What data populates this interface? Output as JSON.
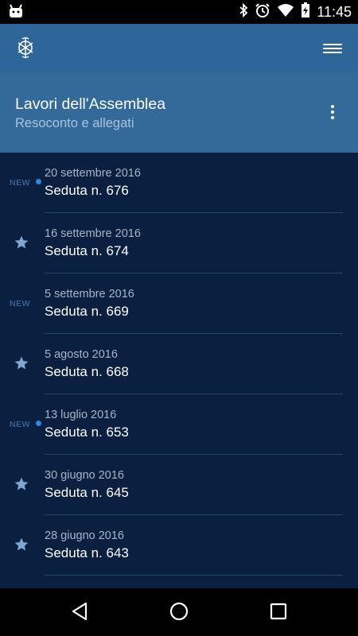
{
  "status_bar": {
    "time": "11:45",
    "icons": [
      "android-icon",
      "bluetooth-icon",
      "alarm-icon",
      "wifi-icon",
      "battery-charging-icon"
    ]
  },
  "app_bar": {
    "logo_icon": "assembly-logo-icon",
    "menu_icon": "hamburger-menu-icon"
  },
  "header": {
    "title": "Lavori dell'Assemblea",
    "subtitle": "Resoconto e allegati",
    "overflow_icon": "more-vert-icon"
  },
  "sessions": [
    {
      "date": "20 settembre 2016",
      "name": "Seduta n. 676",
      "marker": "new",
      "new_label": "NEW"
    },
    {
      "date": "16 settembre 2016",
      "name": "Seduta n. 674",
      "marker": "star"
    },
    {
      "date": "5 settembre 2016",
      "name": "Seduta n. 669",
      "marker": "new-label",
      "new_label": "NEW"
    },
    {
      "date": "5 agosto 2016",
      "name": "Seduta n. 668",
      "marker": "star"
    },
    {
      "date": "13 luglio 2016",
      "name": "Seduta n. 653",
      "marker": "new",
      "new_label": "NEW"
    },
    {
      "date": "30 giugno 2016",
      "name": "Seduta n. 645",
      "marker": "star"
    },
    {
      "date": "28 giugno 2016",
      "name": "Seduta n. 643",
      "marker": "star"
    }
  ],
  "colors": {
    "app_bar": "#2f6699",
    "header": "#336a9a",
    "background": "#0b2040",
    "new_dot": "#2e86e6",
    "star": "#7ea6d1"
  },
  "nav_bar": {
    "back_icon": "back-triangle-icon",
    "home_icon": "home-circle-icon",
    "recents_icon": "recents-square-icon"
  }
}
